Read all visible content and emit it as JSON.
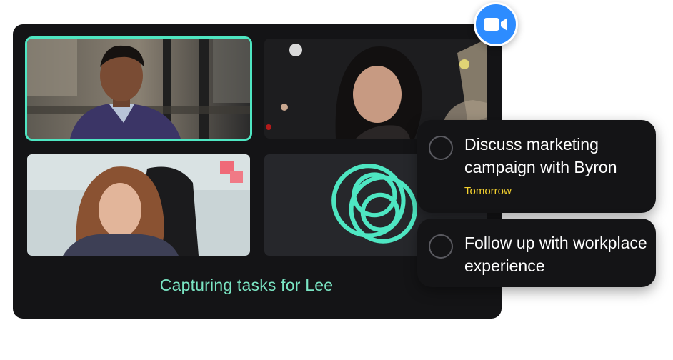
{
  "meeting": {
    "caption": "Capturing tasks for Lee",
    "participants": [
      {
        "name": "participant-1",
        "active_speaker": true
      },
      {
        "name": "participant-2",
        "active_speaker": false
      },
      {
        "name": "participant-3",
        "active_speaker": false
      },
      {
        "name": "notetaker-bot",
        "icon": "overlapping-circles-logo-icon"
      }
    ]
  },
  "app_badge": {
    "icon": "video-camera-icon",
    "color": "#2d8cff"
  },
  "tasks": [
    {
      "title": "Discuss marketing campaign with Byron",
      "due": "Tomorrow"
    },
    {
      "title": "Follow up with workplace experience"
    }
  ],
  "colors": {
    "accent": "#4ee6c2",
    "caption": "#7ae5c3",
    "due": "#f5d22f",
    "panel": "#141416",
    "zoom_blue": "#2d8cff"
  }
}
